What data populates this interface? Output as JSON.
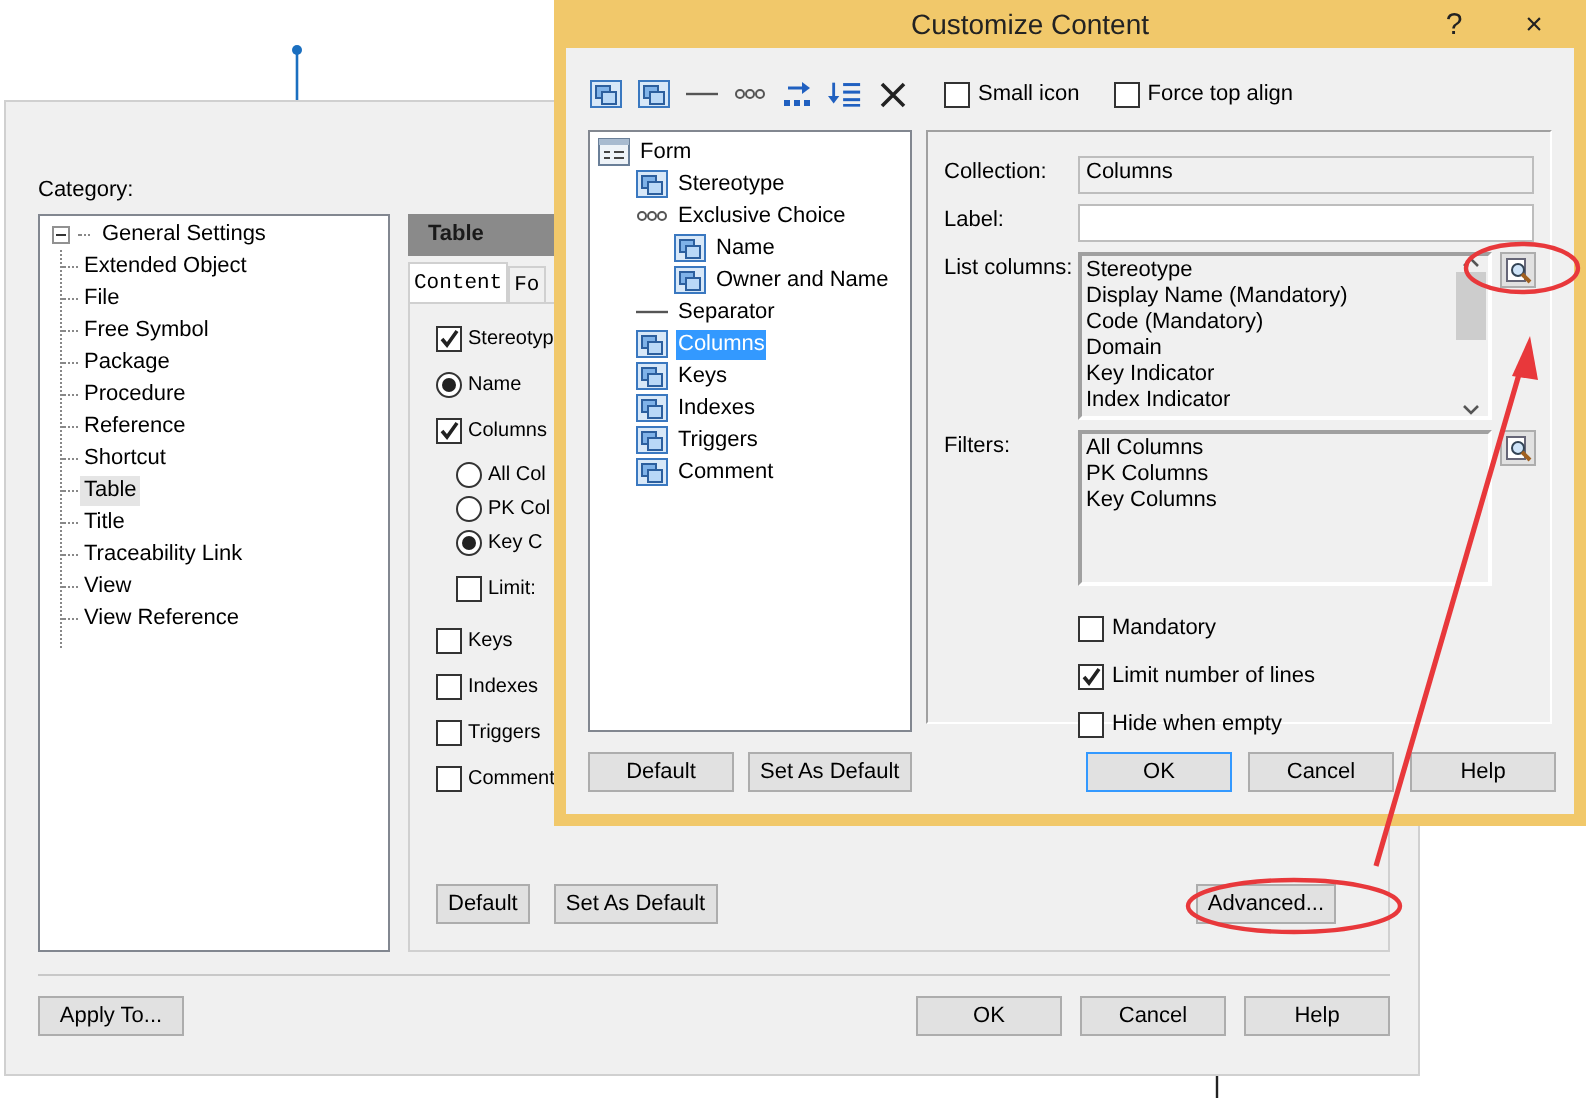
{
  "background_dialog": {
    "category_label": "Category:",
    "category_tree": [
      {
        "label": "General Settings",
        "expanded": true,
        "selected": false,
        "children": [
          {
            "label": "Extended Object",
            "selected": false
          },
          {
            "label": "File",
            "selected": false
          },
          {
            "label": "Free Symbol",
            "selected": false
          },
          {
            "label": "Package",
            "selected": false
          },
          {
            "label": "Procedure",
            "selected": false
          },
          {
            "label": "Reference",
            "selected": false
          },
          {
            "label": "Shortcut",
            "selected": false
          },
          {
            "label": "Table",
            "selected": true
          },
          {
            "label": "Title",
            "selected": false
          },
          {
            "label": "Traceability Link",
            "selected": false
          },
          {
            "label": "View",
            "selected": false
          },
          {
            "label": "View Reference",
            "selected": false
          }
        ]
      }
    ],
    "panel_title": "Table",
    "tabs": [
      {
        "label": "Content",
        "selected": true
      },
      {
        "label": "Fo",
        "selected": false
      }
    ],
    "content_items": [
      {
        "kind": "checkbox",
        "label": "Stereotyp",
        "checked": true
      },
      {
        "kind": "radio",
        "label": "Name",
        "selected": true
      },
      {
        "kind": "checkbox",
        "label": "Columns",
        "checked": true,
        "children": [
          {
            "kind": "radio",
            "label": "All Col",
            "selected": false
          },
          {
            "kind": "radio",
            "label": "PK Col",
            "selected": false
          },
          {
            "kind": "radio",
            "label": "Key C",
            "selected": true
          },
          {
            "kind": "checkbox",
            "label": "Limit:",
            "checked": false
          }
        ]
      },
      {
        "kind": "checkbox",
        "label": "Keys",
        "checked": false
      },
      {
        "kind": "checkbox",
        "label": "Indexes",
        "checked": false
      },
      {
        "kind": "checkbox",
        "label": "Triggers",
        "checked": false
      },
      {
        "kind": "checkbox",
        "label": "Comment",
        "checked": false
      }
    ],
    "panel_buttons": [
      "Default",
      "Set As Default"
    ],
    "advanced_button": "Advanced...",
    "footer_button": "Apply To...",
    "buttons": [
      "OK",
      "Cancel",
      "Help"
    ]
  },
  "customize_dialog": {
    "title": "Customize Content",
    "help_button": "?",
    "close_button": "×",
    "toolbar_options": [
      {
        "label": "Small icon",
        "checked": false
      },
      {
        "label": "Force top align",
        "checked": false
      }
    ],
    "tree": [
      {
        "label": "Form",
        "kind": "form",
        "selected": false,
        "children": [
          {
            "label": "Stereotype",
            "kind": "attribute",
            "selected": false
          },
          {
            "label": "Exclusive Choice",
            "kind": "choice",
            "selected": false,
            "children": [
              {
                "label": "Name",
                "kind": "attribute",
                "selected": false
              },
              {
                "label": "Owner and Name",
                "kind": "attribute",
                "selected": false
              }
            ]
          },
          {
            "label": "Separator",
            "kind": "separator",
            "selected": false
          },
          {
            "label": "Columns",
            "kind": "attribute",
            "selected": true
          },
          {
            "label": "Keys",
            "kind": "attribute",
            "selected": false
          },
          {
            "label": "Indexes",
            "kind": "attribute",
            "selected": false
          },
          {
            "label": "Triggers",
            "kind": "attribute",
            "selected": false
          },
          {
            "label": "Comment",
            "kind": "attribute",
            "selected": false
          }
        ]
      }
    ],
    "collection": {
      "label": "Collection:",
      "value": "Columns"
    },
    "label_field": {
      "label": "Label:"
    },
    "list_columns": {
      "label": "List columns:",
      "items": [
        "Stereotype",
        "Display Name (Mandatory)",
        "Code (Mandatory)",
        "Domain",
        "Key Indicator",
        "Index Indicator"
      ]
    },
    "filters": {
      "label": "Filters:",
      "items": [
        "All Columns",
        "PK Columns",
        "Key Columns"
      ]
    },
    "options": [
      {
        "label": "Mandatory",
        "checked": false
      },
      {
        "label": "Limit number of lines",
        "checked": true
      },
      {
        "label": "Hide when empty",
        "checked": false
      }
    ],
    "buttons": [
      {
        "label": "Default",
        "focused": false
      },
      {
        "label": "Set As Default",
        "focused": false
      },
      {
        "label": "OK",
        "focused": true
      },
      {
        "label": "Cancel",
        "focused": false
      },
      {
        "label": "Help",
        "focused": false
      }
    ]
  }
}
